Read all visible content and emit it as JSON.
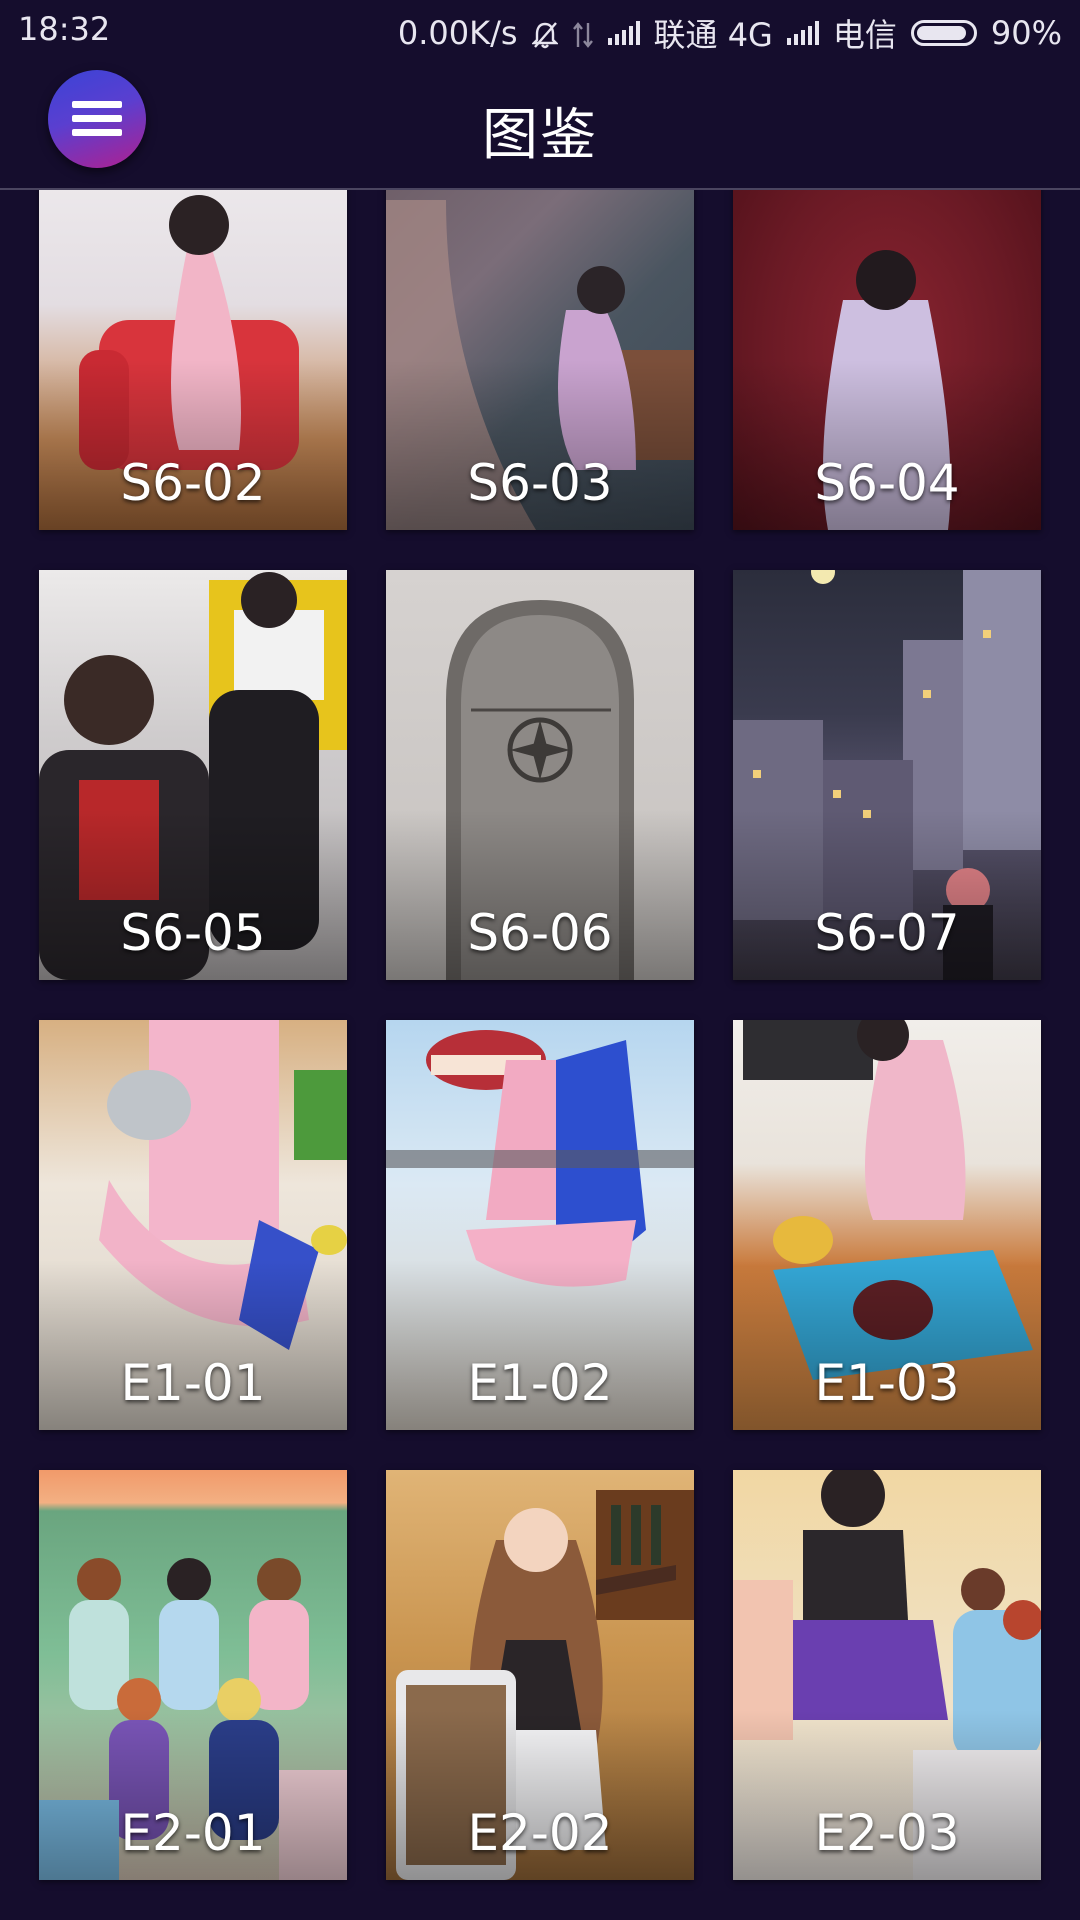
{
  "status_bar": {
    "time": "18:32",
    "net_speed": "0.00K/s",
    "carrier1": "联通 4G",
    "carrier2": "电信",
    "battery": "90%",
    "battery_level": 0.9,
    "icons": [
      "bell-mute-icon",
      "data-transfer-icon",
      "signal-icon",
      "signal-icon",
      "battery-icon"
    ]
  },
  "app_bar": {
    "title": "图鉴",
    "menu_icon": "hamburger-menu-icon",
    "accent_gradient": [
      "#3b43d6",
      "#b0208f"
    ]
  },
  "colors": {
    "background": "#150d2d",
    "text": "#ffffff"
  },
  "gallery": [
    {
      "label": "S6-02"
    },
    {
      "label": "S6-03"
    },
    {
      "label": "S6-04"
    },
    {
      "label": "S6-05"
    },
    {
      "label": "S6-06"
    },
    {
      "label": "S6-07"
    },
    {
      "label": "E1-01"
    },
    {
      "label": "E1-02"
    },
    {
      "label": "E1-03"
    },
    {
      "label": "E2-01"
    },
    {
      "label": "E2-02"
    },
    {
      "label": "E2-03"
    }
  ]
}
